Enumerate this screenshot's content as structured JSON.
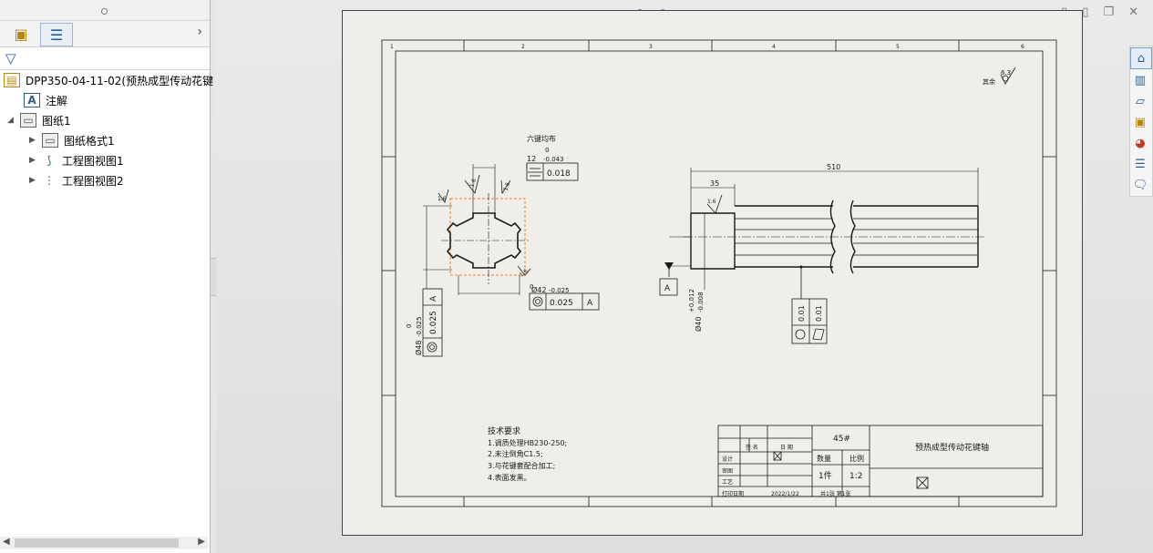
{
  "feature_tree": {
    "root_label": "DPP350-04-11-02(预热成型传动花键",
    "annotations_label": "注解",
    "sheet_label": "图纸1",
    "sheet_format_label": "图纸格式1",
    "view1_label": "工程图视图1",
    "view2_label": "工程图视图2"
  },
  "drawing": {
    "zone_numbers": [
      "1",
      "2",
      "3",
      "4",
      "5",
      "6"
    ],
    "roughness_general": "6.3",
    "roughness_general_prefix": "其余",
    "spline_note": "六键均布",
    "dim_key_width": "12",
    "dim_key_width_tol_upper": "0",
    "dim_key_width_tol_lower": "-0.043",
    "symmetry_tol": "0.018",
    "roughness_small": "1.6",
    "dim_inner_dia": "Ø42",
    "dim_inner_tol_upper": "0",
    "dim_inner_tol_lower": "-0.025",
    "concentricity_tol": "0.025",
    "datum_a": "A",
    "dim_outer_dia": "Ø48",
    "dim_outer_tol_upper": "0",
    "dim_outer_tol_lower": "-0.025",
    "dim_total_length": "510",
    "dim_step_length": "35",
    "dim_shaft_dia": "Ø40",
    "dim_shaft_tol_upper": "+0.012",
    "dim_shaft_tol_lower": "-0.008",
    "runout_tol_1": "0.01",
    "runout_tol_2": "0.01",
    "tech_req_title": "技术要求",
    "tech_req_1": "1.调质处理HB230-250;",
    "tech_req_2": "2.未注倒角C1.5;",
    "tech_req_3": "3.与花键套配合加工;",
    "tech_req_4": "4.表面发黑。",
    "tb_material": "45#",
    "tb_part_name": "预热成型传动花键轴",
    "tb_sign_label": "签 名",
    "tb_date_label": "日 期",
    "tb_design_label": "设计",
    "tb_review_label": "审图",
    "tb_process_label": "工艺",
    "tb_qty_label": "数量",
    "tb_scale_label": "比例",
    "tb_qty_value": "1件",
    "tb_scale_value": "1:2",
    "tb_sheets": "共1张 第1张",
    "tb_print_date_label": "打印日期",
    "tb_print_date": "2022/1/22"
  },
  "colors": {
    "sheet_bg": "#efeeea",
    "line": "#1a1a1a",
    "selection": "#f07f1e"
  }
}
